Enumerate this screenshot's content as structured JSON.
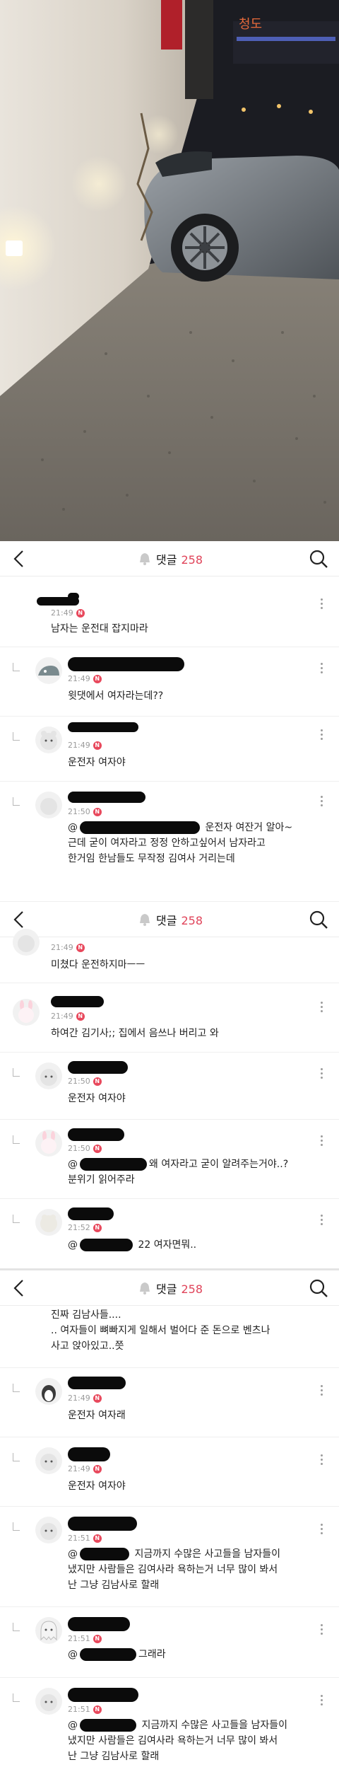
{
  "header": {
    "title": "댓글",
    "count": "258"
  },
  "section1": {
    "comments": [
      {
        "time": "21:49",
        "badge": "N",
        "text": "남자는 운전대 잡지마라"
      },
      {
        "time": "21:49",
        "badge": "N",
        "text": "윗댓에서 여자라는데??"
      },
      {
        "time": "21:49",
        "badge": "N",
        "text": "운전자 여자야"
      },
      {
        "time": "21:50",
        "badge": "N",
        "line1_prefix": "@",
        "line1_suffix": " 운전자 여잔거 알아~",
        "line2": "근데 굳이 여자라고 정정 안하고싶어서 남자라고",
        "line3": "한거임 한남들도 무작정 김여사 거리는데"
      }
    ]
  },
  "section2": {
    "comments": [
      {
        "time": "21:49",
        "badge": "N",
        "text": "미쳤다 운전하지마ㅡㅡ"
      },
      {
        "time": "21:49",
        "badge": "N",
        "text": "하여간 김기사;; 집에서 음쓰나 버리고 와"
      },
      {
        "time": "21:50",
        "badge": "N",
        "text": "운전자 여자야"
      },
      {
        "time": "21:50",
        "badge": "N",
        "line1_prefix": "@",
        "line1_suffix": "왜 여자라고 굳이 알려주는거야..?",
        "line2": "분위기 읽어주라"
      },
      {
        "time": "21:52",
        "badge": "N",
        "line1_prefix": "@",
        "line1_suffix": " 22 여자면뭐.."
      }
    ]
  },
  "section3": {
    "top_lines": [
      "진짜 김남사들....",
      ".. 여자들이 뼈빠지게 일해서 벌어다 준 돈으로 벤츠나",
      "사고 앉아있고..쯧"
    ],
    "comments": [
      {
        "time": "21:49",
        "badge": "N",
        "text": "운전자 여자래"
      },
      {
        "time": "21:49",
        "badge": "N",
        "text": "운전자 여자야"
      },
      {
        "time": "21:51",
        "badge": "N",
        "line1_prefix": "@",
        "line1_suffix": " 지금까지 수많은 사고들을 남자들이",
        "line2": "냈지만 사람들은 김여사라 욕하는거 너무 많이 봐서",
        "line3": "난 그냥 김남사로 할래"
      },
      {
        "time": "21:51",
        "badge": "N",
        "line1_prefix": "@",
        "line1_suffix": "그래라"
      },
      {
        "time": "21:51",
        "badge": "N",
        "line1_prefix": "@",
        "line1_suffix": " 지금까지 수많은 사고들을 남자들이",
        "line2": "냈지만 사람들은 김여사라 욕하는거 너무 많이 봐서",
        "line3": "난 그냥 김남사로 할래"
      }
    ]
  },
  "photo": {
    "sign_text": "청도"
  },
  "icons": {
    "back": "chevron-left-icon",
    "search": "search-icon",
    "bell": "bell-icon",
    "more": "kebab-icon"
  },
  "colors": {
    "accent": "#e0445a",
    "badge": "#e8485c",
    "meta": "#9a9a9a"
  }
}
